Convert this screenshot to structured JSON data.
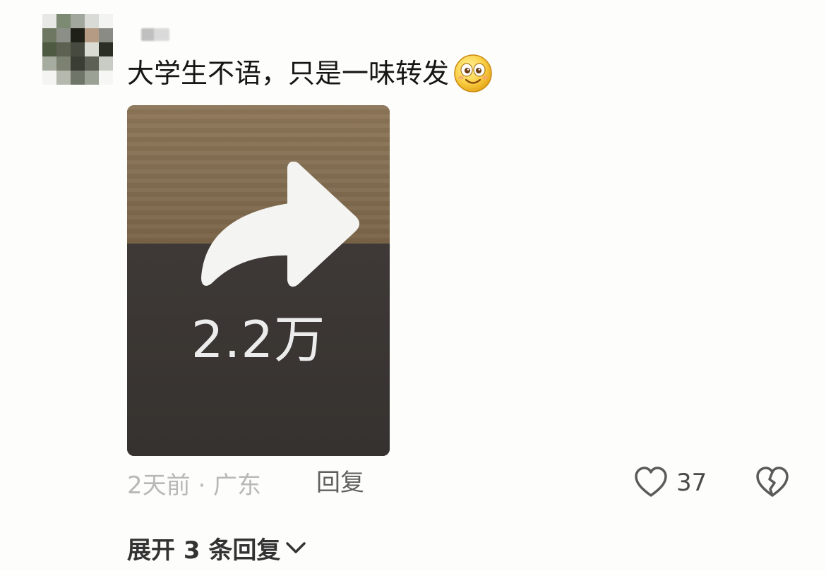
{
  "comment": {
    "text": "大学生不语，只是一味转发",
    "emoji": "smiling-face-emoji",
    "attached_image": {
      "share_count": "2.2万",
      "icon": "share-arrow-icon"
    },
    "meta": {
      "time_location": "2天前 · 广东",
      "reply_label": "回复",
      "like_count": "37"
    },
    "expand_replies_label": "展开 3 条回复"
  },
  "colors": {
    "text_primary": "#161616",
    "text_secondary": "#b8b8b8",
    "image_wood": "#826d51",
    "image_dark": "#3b3634"
  }
}
